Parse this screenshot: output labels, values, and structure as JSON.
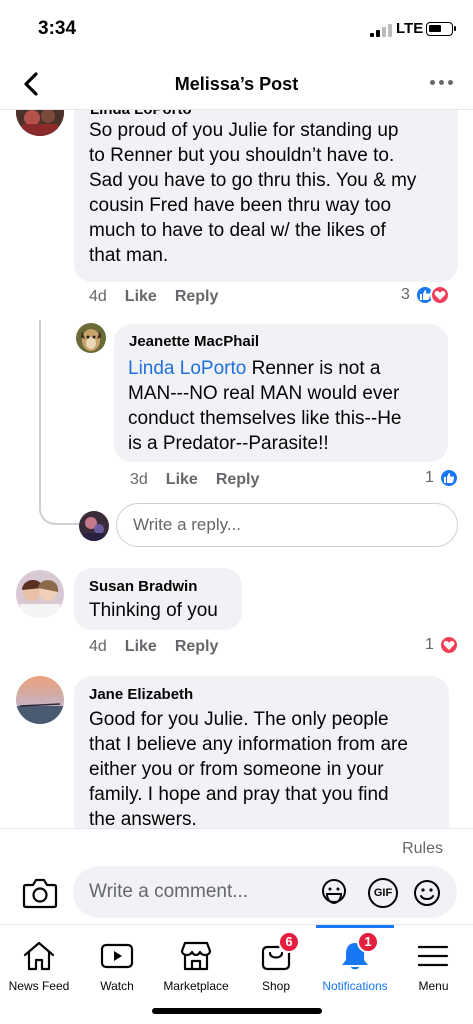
{
  "status_bar": {
    "time": "3:34",
    "network": "LTE"
  },
  "header": {
    "title": "Melissa’s Post"
  },
  "comments": [
    {
      "author": "Linda LoPorto",
      "lines": [
        "So proud of you Julie for standing up",
        "to Renner but you shouldn’t have to.",
        "Sad you have to go thru this. You & my",
        "cousin Fred have been thru way  too",
        "much to have to deal w/ the likes of",
        "that man."
      ],
      "age": "4d",
      "like_label": "Like",
      "reply_label": "Reply",
      "reaction_count": "3",
      "reactions": [
        "like",
        "love"
      ]
    },
    {
      "author": "Jeanette MacPhail",
      "mention": "Linda LoPorto",
      "first_line_rest": " Renner is not a",
      "lines": [
        "MAN---NO real MAN would ever",
        "conduct themselves like this--He",
        "is a Predator--Parasite!!"
      ],
      "age": "3d",
      "like_label": "Like",
      "reply_label": "Reply",
      "reaction_count": "1",
      "reactions": [
        "like"
      ]
    },
    {
      "author": "Susan Bradwin",
      "lines": [
        "Thinking of you"
      ],
      "age": "4d",
      "like_label": "Like",
      "reply_label": "Reply",
      "reaction_count": "1",
      "reactions": [
        "love"
      ]
    },
    {
      "author": "Jane Elizabeth",
      "lines": [
        "Good for you Julie. The only people",
        "that I believe any information from are",
        "either you or from someone in your",
        "family. I hope and pray that you find",
        "the answers."
      ]
    }
  ],
  "reply_input": {
    "placeholder": "Write a reply..."
  },
  "composer": {
    "rules_label": "Rules",
    "placeholder": "Write a comment...",
    "gif_label": "GIF"
  },
  "tabbar": {
    "tabs": [
      {
        "label": "News Feed",
        "icon": "home-icon"
      },
      {
        "label": "Watch",
        "icon": "video-icon"
      },
      {
        "label": "Marketplace",
        "icon": "storefront-icon"
      },
      {
        "label": "Shop",
        "icon": "shopping-bag-icon",
        "badge": "6"
      },
      {
        "label": "Notifications",
        "icon": "bell-icon",
        "badge": "1",
        "active": true
      },
      {
        "label": "Menu",
        "icon": "hamburger-icon"
      }
    ]
  },
  "colors": {
    "accent": "#1877f2",
    "badge": "#e41e3f",
    "bubble": "#f0f2f5",
    "mention": "#216fdb",
    "love": "#f33e58"
  }
}
